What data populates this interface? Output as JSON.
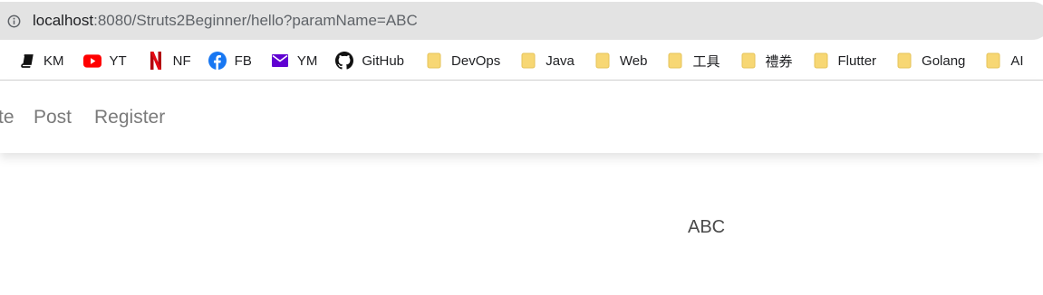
{
  "browser": {
    "url_host": "localhost",
    "url_rest": ":8080/Struts2Beginner/hello?paramName=ABC"
  },
  "bookmarks": [
    {
      "label": "KM",
      "icon": "book-icon"
    },
    {
      "label": "YT",
      "icon": "youtube-icon"
    },
    {
      "label": "NF",
      "icon": "netflix-icon"
    },
    {
      "label": "FB",
      "icon": "facebook-icon"
    },
    {
      "label": "YM",
      "icon": "mail-icon"
    },
    {
      "label": "GitHub",
      "icon": "github-icon"
    },
    {
      "label": "DevOps",
      "icon": "folder-icon"
    },
    {
      "label": "Java",
      "icon": "folder-icon"
    },
    {
      "label": "Web",
      "icon": "folder-icon"
    },
    {
      "label": "工具",
      "icon": "folder-icon"
    },
    {
      "label": "禮券",
      "icon": "folder-icon"
    },
    {
      "label": "Flutter",
      "icon": "folder-icon"
    },
    {
      "label": "Golang",
      "icon": "folder-icon"
    },
    {
      "label": "AI",
      "icon": "folder-icon"
    }
  ],
  "nav": {
    "partial_label": "te",
    "post_label": "Post",
    "register_label": "Register"
  },
  "content": {
    "param_value": "ABC"
  },
  "colors": {
    "youtube": "#ff0000",
    "netflix": "#e50914",
    "facebook": "#1877f2",
    "ymail": "#6001d2",
    "folder": "#f7d774"
  }
}
